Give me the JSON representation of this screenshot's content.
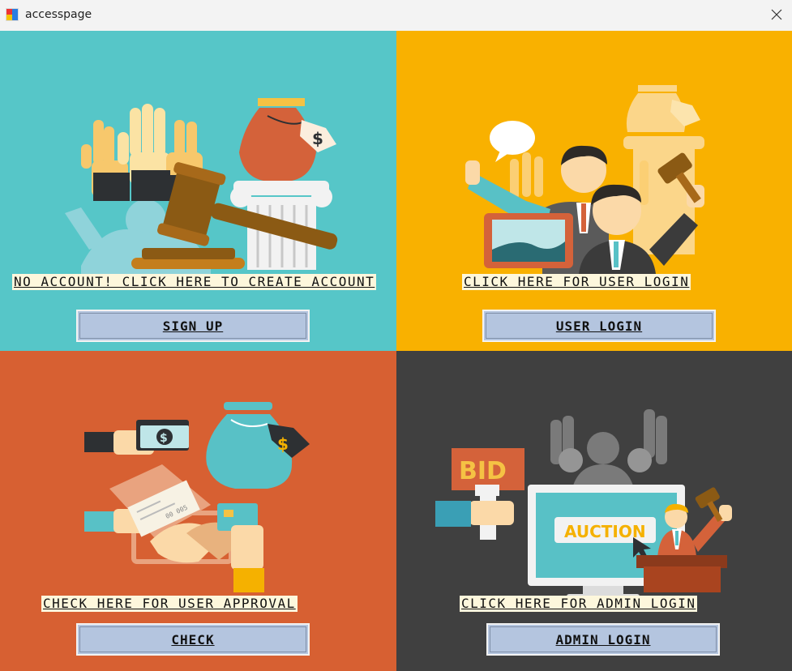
{
  "window": {
    "title": "accesspage"
  },
  "panels": {
    "signup": {
      "caption": " NO ACCOUNT! CLICK HERE TO CREATE ACCOUNT",
      "button": "SIGN UP",
      "color": "#56c6c8"
    },
    "user": {
      "caption": "CLICK HERE FOR USER LOGIN",
      "button": "USER LOGIN",
      "color": "#f9b100"
    },
    "approval": {
      "caption": "CHECK HERE FOR USER APPROVAL",
      "button": "CHECK",
      "color": "#d76032"
    },
    "admin": {
      "caption": "CLICK HERE FOR ADMIN LOGIN",
      "button": "ADMIN LOGIN",
      "color": "#404040"
    }
  },
  "illustrations": {
    "approval_currency": "$",
    "approval_check_number": "00 005",
    "admin_bid_sign": "BID",
    "admin_screen_banner": "AUCTION"
  },
  "icons": [
    "app-icon",
    "close-icon"
  ]
}
